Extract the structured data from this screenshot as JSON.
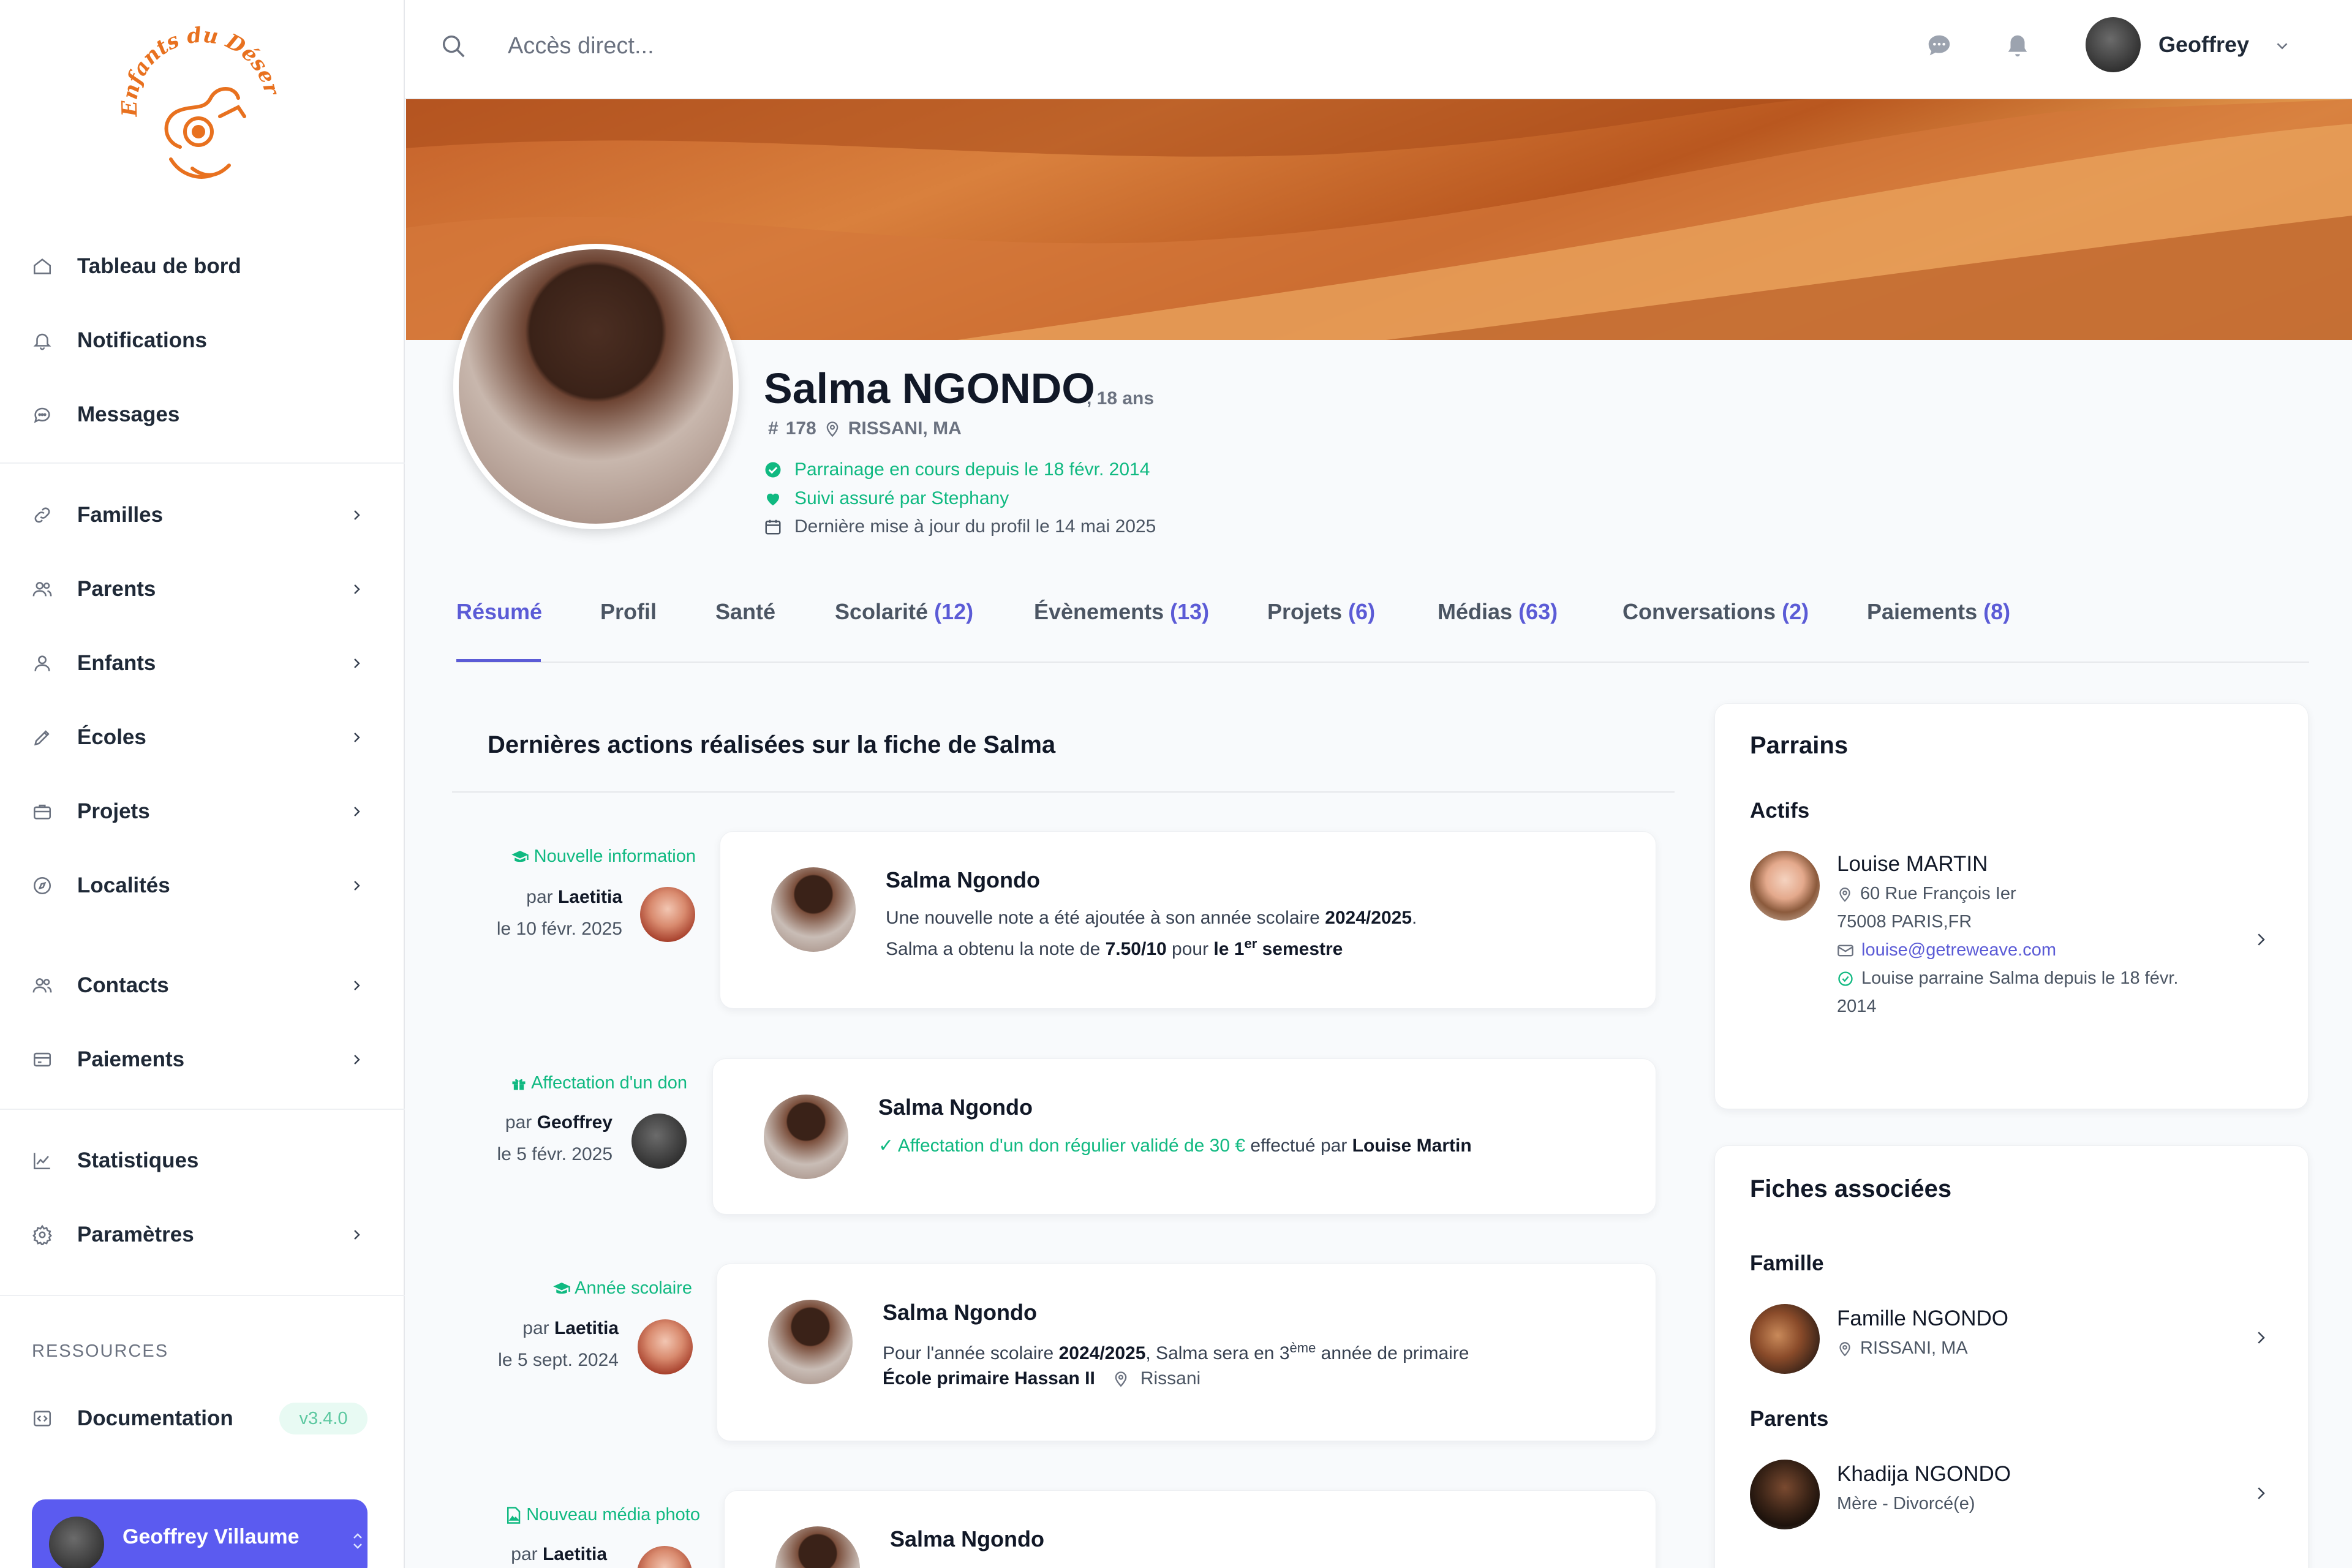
{
  "app": {
    "logo_text": "Enfants du Désert"
  },
  "sidebar": {
    "items": [
      {
        "label": "Tableau de bord",
        "icon": "home-icon"
      },
      {
        "label": "Notifications",
        "icon": "bell-icon"
      },
      {
        "label": "Messages",
        "icon": "chat-icon"
      },
      {
        "label": "Familles",
        "icon": "link-icon"
      },
      {
        "label": "Parents",
        "icon": "users-icon"
      },
      {
        "label": "Enfants",
        "icon": "user-icon"
      },
      {
        "label": "Écoles",
        "icon": "pencil-icon"
      },
      {
        "label": "Projets",
        "icon": "briefcase-icon"
      },
      {
        "label": "Localités",
        "icon": "compass-icon"
      },
      {
        "label": "Contacts",
        "icon": "users-icon"
      },
      {
        "label": "Paiements",
        "icon": "credit-card-icon"
      },
      {
        "label": "Statistiques",
        "icon": "chart-icon"
      },
      {
        "label": "Paramètres",
        "icon": "gear-icon"
      }
    ],
    "resources_title": "RESSOURCES",
    "documentation": {
      "label": "Documentation",
      "version": "v3.4.0"
    },
    "user": {
      "name": "Geoffrey Villaume"
    }
  },
  "topbar": {
    "search_placeholder": "Accès direct...",
    "user_name": "Geoffrey"
  },
  "profile": {
    "name": "Salma NGONDO",
    "age": ", 18 ans",
    "id": "178",
    "location": "RISSANI, MA",
    "sponsorship": "Parrainage en cours depuis le 18 févr. 2014",
    "followed_by": "Suivi assuré par Stephany",
    "last_update": "Dernière mise à jour du profil le 14 mai 2025"
  },
  "tabs": [
    {
      "label": "Résumé",
      "count": ""
    },
    {
      "label": "Profil",
      "count": ""
    },
    {
      "label": "Santé",
      "count": ""
    },
    {
      "label": "Scolarité",
      "count": "(12)"
    },
    {
      "label": "Évènements",
      "count": "(13)"
    },
    {
      "label": "Projets",
      "count": "(6)"
    },
    {
      "label": "Médias",
      "count": "(63)"
    },
    {
      "label": "Conversations",
      "count": "(2)"
    },
    {
      "label": "Paiements",
      "count": "(8)"
    }
  ],
  "timeline": {
    "title": "Dernières actions réalisées sur la fiche de Salma",
    "by_prefix": "par",
    "events": [
      {
        "type": "Nouvelle information",
        "author": "Laetitia",
        "date": "le 10 févr. 2025",
        "card_title": "Salma Ngondo",
        "line1_a": "Une nouvelle note a été ajoutée à son année scolaire ",
        "line1_b": "2024/2025",
        "line1_c": ".",
        "line2_a": "Salma a obtenu la note de ",
        "line2_b": "7.50/10",
        "line2_c": " pour ",
        "line2_d": "le 1",
        "line2_sup": "er",
        "line2_e": " semestre"
      },
      {
        "type": "Affectation d'un don",
        "author": "Geoffrey",
        "date": "le 5 févr. 2025",
        "card_title": "Salma Ngondo",
        "line1_a": "Affectation d'un don régulier validé de 30 €",
        "line1_b": " effectué par ",
        "line1_c": "Louise Martin"
      },
      {
        "type": "Année scolaire",
        "author": "Laetitia",
        "date": "le 5 sept. 2024",
        "card_title": "Salma Ngondo",
        "line1_a": "Pour l'année scolaire ",
        "line1_b": "2024/2025",
        "line1_c": ", Salma sera en 3",
        "line1_sup": "ème",
        "line1_d": " année de primaire",
        "school": "École primaire Hassan II",
        "city": "Rissani"
      },
      {
        "type": "Nouveau média photo",
        "author": "Laetitia",
        "card_title": "Salma Ngondo"
      }
    ]
  },
  "parrains": {
    "title": "Parrains",
    "subtitle": "Actifs",
    "sponsor": {
      "name": "Louise MARTIN",
      "address1": "60 Rue François Ier",
      "address2": "75008 PARIS,FR",
      "email": "louise@getreweave.com",
      "since_1": "Louise parraine Salma depuis le 18 févr.",
      "since_2": "2014"
    }
  },
  "fiches": {
    "title": "Fiches associées",
    "famille_title": "Famille",
    "famille": {
      "name": "Famille NGONDO",
      "location": "RISSANI, MA"
    },
    "parents_title": "Parents",
    "parent": {
      "name": "Khadija NGONDO",
      "detail": "Mère - Divorcé(e)"
    }
  },
  "colors": {
    "accent": "#5b5bd6",
    "success": "#10b981",
    "brand_orange": "#e8711f"
  }
}
